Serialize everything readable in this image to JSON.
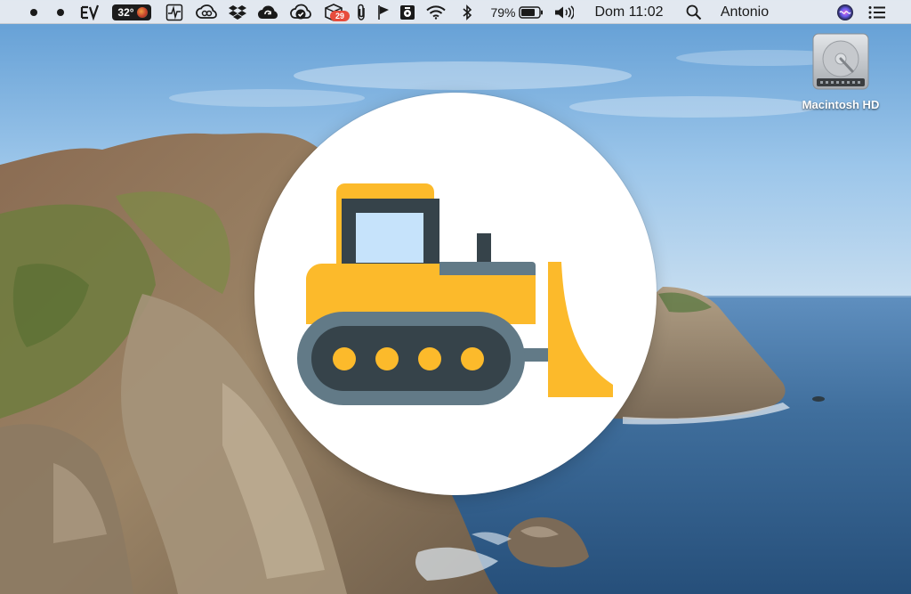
{
  "menubar": {
    "temperature": "32°",
    "notification_count": "29",
    "battery_percent": "79%",
    "datetime": "Dom 11:02",
    "user_name": "Antonio"
  },
  "desktop": {
    "disk_label": "Macintosh HD"
  },
  "app": {
    "icon": "bulldozer-icon",
    "colors": {
      "yellow": "#FCBA2B",
      "dark": "#36434A",
      "steel": "#627A87",
      "window": "#C6E3FB"
    }
  },
  "colors": {
    "sky": "#7FB3DE",
    "sea": "#3D6E9E",
    "menubar": "#ECEEF2"
  }
}
